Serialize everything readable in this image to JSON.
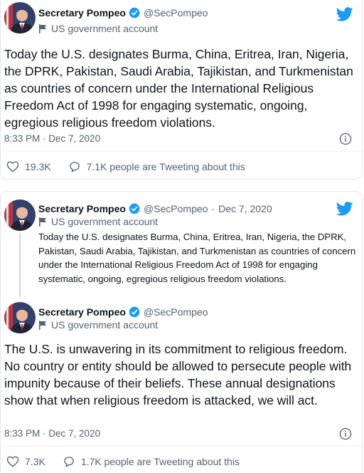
{
  "tweet1": {
    "author_name": "Secretary Pompeo",
    "handle": "@SecPompeo",
    "label": "US government account",
    "text": "Today the U.S. designates Burma, China, Eritrea, Iran, Nigeria, the DPRK, Pakistan, Saudi Arabia, Tajikistan, and Turkmenistan as countries of concern under the International Religious Freedom Act of 1998 for engaging systematic, ongoing, egregious religious freedom violations.",
    "timestamp": "8:33 PM · Dec 7, 2020",
    "likes": "19.3K",
    "conversation": "7.1K people are Tweeting about this"
  },
  "quoted": {
    "author_name": "Secretary Pompeo",
    "handle": "@SecPompeo",
    "date": "Dec 7, 2020",
    "label": "US government account",
    "text": "Today the U.S. designates Burma, China, Eritrea, Iran, Nigeria, the DPRK, Pakistan, Saudi Arabia, Tajikistan, and Turkmenistan as countries of concern under the International Religious Freedom Act of 1998 for engaging systematic, ongoing, egregious religious freedom violations."
  },
  "tweet2": {
    "author_name": "Secretary Pompeo",
    "handle": "@SecPompeo",
    "label": "US government account",
    "text": "The U.S. is unwavering in its commitment to religious freedom. No country or entity should be allowed to persecute people with impunity because of their beliefs. These annual designations show that when religious freedom is attacked, we will act.",
    "timestamp": "8:33 PM · Dec 7, 2020",
    "likes": "7.3K",
    "conversation": "1.7K people are Tweeting about this"
  },
  "colors": {
    "twitter_blue": "#1d9bf0",
    "text_primary": "#0f1419",
    "text_secondary": "#536471"
  },
  "icons": [
    "avatar",
    "verified-badge-icon",
    "government-flag-icon",
    "twitter-bird-icon",
    "info-icon",
    "heart-icon",
    "speech-bubble-icon"
  ]
}
